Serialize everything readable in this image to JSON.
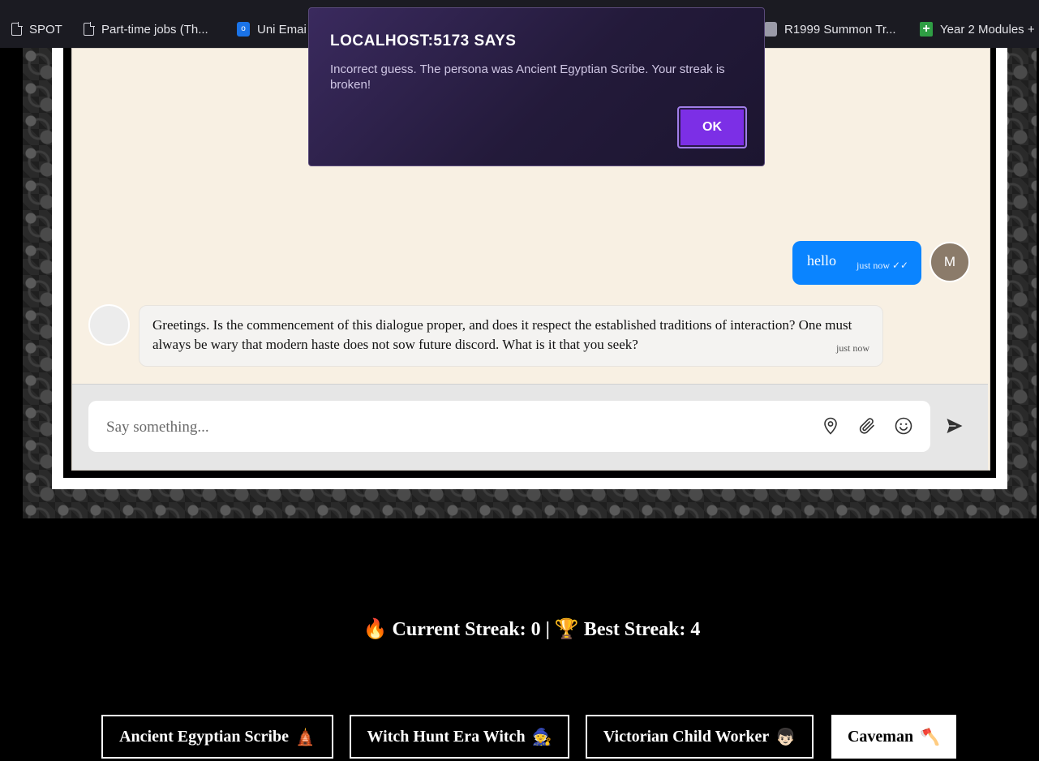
{
  "bookmarks": [
    {
      "label": "SPOT",
      "icon": "document-icon"
    },
    {
      "label": "Part-time jobs (Th...",
      "icon": "document-icon"
    },
    {
      "label": "Uni Emai",
      "icon": "mail-icon"
    },
    {
      "label": "R1999 Summon Tr...",
      "icon": "game-icon"
    },
    {
      "label": "Year 2 Modules +",
      "icon": "plus-icon"
    }
  ],
  "dialog": {
    "title": "LOCALHOST:5173 SAYS",
    "message": "Incorrect guess. The persona was Ancient Egyptian Scribe. Your streak is broken!",
    "ok_label": "OK"
  },
  "chat": {
    "messages": [
      {
        "sender": "user",
        "text": "hello",
        "time": "just now ✓✓",
        "avatar_initial": "M"
      },
      {
        "sender": "bot",
        "text": "Greetings. Is the commencement of this dialogue proper, and does it respect the established traditions of interaction? One must always be wary that modern haste does not sow future discord. What is it that you seek?",
        "time": "just now"
      }
    ],
    "input_placeholder": "Say something..."
  },
  "streak": {
    "current_icon": "🔥",
    "current_text": "Current Streak: 0 |",
    "best_icon": "🏆",
    "best_text": "Best Streak: 4"
  },
  "personas": [
    {
      "label": "Ancient Egyptian Scribe",
      "emoji": "🛕"
    },
    {
      "label": "Witch Hunt Era Witch",
      "emoji": "🧙"
    },
    {
      "label": "Victorian Child Worker",
      "emoji": "👦🏻"
    },
    {
      "label": "Caveman",
      "emoji": "🪓"
    }
  ],
  "colors": {
    "accent_purple": "#7c2fe6",
    "user_bubble": "#0a84ff",
    "chat_bg": "#f8f0e3"
  }
}
